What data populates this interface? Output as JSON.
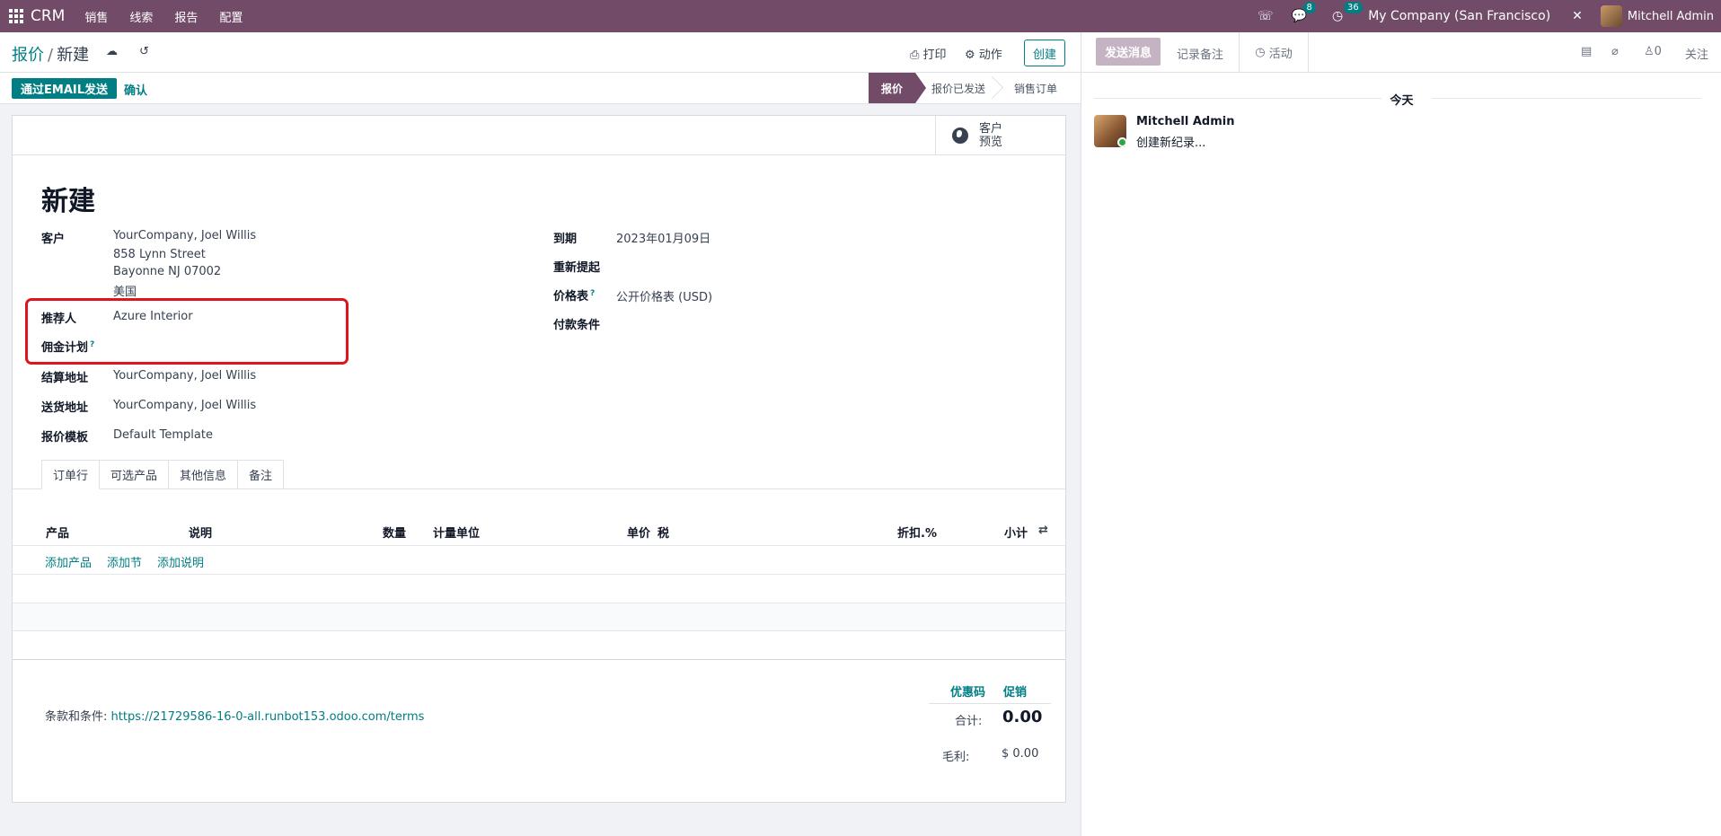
{
  "navbar": {
    "brand": "CRM",
    "menus": [
      "销售",
      "线索",
      "报告",
      "配置"
    ],
    "messages_count": "8",
    "activities_count": "36",
    "company": "My Company (San Francisco)",
    "user": "Mitchell Admin"
  },
  "control": {
    "breadcrumb_parent": "报价",
    "breadcrumb_current": "新建",
    "print_label": "打印",
    "action_label": "动作",
    "create_label": "创建"
  },
  "statusbar": {
    "email_button": "通过EMAIL发送",
    "confirm_button": "确认",
    "stages": [
      "报价",
      "报价已发送",
      "销售订单"
    ]
  },
  "sheet": {
    "preview_label_1": "客户",
    "preview_label_2": "预览",
    "title": "新建",
    "fields_left": {
      "customer_label": "客户",
      "customer_name": "YourCompany, Joel Willis",
      "customer_street": "858 Lynn Street",
      "customer_city": "Bayonne NJ 07002",
      "customer_country": "美国",
      "referrer_label": "推荐人",
      "referrer_value": "Azure Interior",
      "commission_label": "佣金计划",
      "commission_help": "?",
      "invoice_label": "结算地址",
      "invoice_value": "YourCompany, Joel Willis",
      "delivery_label": "送货地址",
      "delivery_value": "YourCompany, Joel Willis",
      "template_label": "报价模板",
      "template_value": "Default Template"
    },
    "fields_right": {
      "expiration_label": "到期",
      "expiration_value": "2023年01月09日",
      "reminder_label": "重新提起",
      "pricelist_label": "价格表",
      "pricelist_help": "?",
      "pricelist_value": "公开价格表 (USD)",
      "payment_label": "付款条件"
    },
    "tabs": [
      "订单行",
      "可选产品",
      "其他信息",
      "备注"
    ],
    "table_headers": {
      "product": "产品",
      "description": "说明",
      "quantity": "数量",
      "uom": "计量单位",
      "price": "单价",
      "tax": "税",
      "discount": "折扣.%",
      "subtotal": "小计"
    },
    "add_links": [
      "添加产品",
      "添加节",
      "添加说明"
    ],
    "terms_label": "条款和条件:",
    "terms_url": "https://21729586-16-0-all.runbot153.odoo.com/terms",
    "coupon_label": "优惠码",
    "promo_label": "促销",
    "total_label": "合计:",
    "total_value": "0.00",
    "margin_label": "毛利:",
    "margin_value": "$ 0.00"
  },
  "chatter": {
    "send_message": "发送消息",
    "log_note": "记录备注",
    "activity": "活动",
    "followers_count": "0",
    "follow": "关注",
    "today": "今天",
    "author": "Mitchell Admin",
    "body": "创建新纪录..."
  }
}
